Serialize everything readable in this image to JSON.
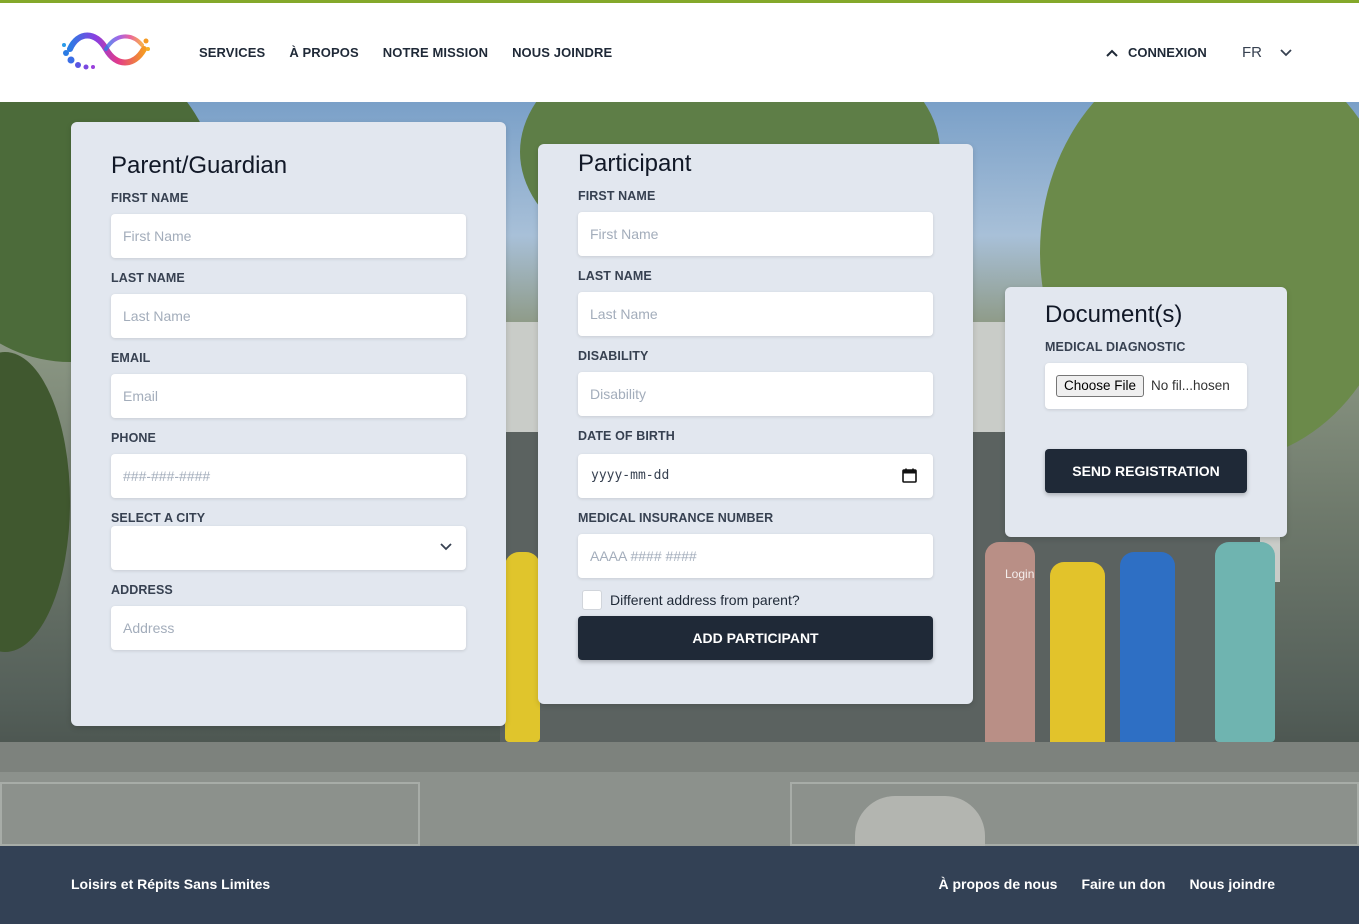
{
  "nav": {
    "items": [
      {
        "label": "SERVICES"
      },
      {
        "label": "À PROPOS"
      },
      {
        "label": "NOTRE MISSION"
      },
      {
        "label": "NOUS JOINDRE"
      }
    ],
    "connexion": "CONNEXION",
    "language": "FR"
  },
  "parent_form": {
    "title": "Parent/Guardian",
    "first_name_label": "FIRST NAME",
    "first_name_placeholder": "First Name",
    "last_name_label": "LAST NAME",
    "last_name_placeholder": "Last Name",
    "email_label": "EMAIL",
    "email_placeholder": "Email",
    "phone_label": "PHONE",
    "phone_placeholder": "###-###-####",
    "city_label": "SELECT A CITY",
    "city_value": "",
    "address_label": "ADDRESS",
    "address_placeholder": "Address"
  },
  "participant_form": {
    "title": "Participant",
    "first_name_label": "FIRST NAME",
    "first_name_placeholder": "First Name",
    "last_name_label": "LAST NAME",
    "last_name_placeholder": "Last Name",
    "disability_label": "DISABILITY",
    "disability_placeholder": "Disability",
    "dob_label": "DATE OF BIRTH",
    "dob_placeholder": "yyyy-mm-dd",
    "insurance_label": "MEDICAL INSURANCE NUMBER",
    "insurance_placeholder": "AAAA #### ####",
    "different_address_label": "Different address from parent?",
    "different_address_checked": false,
    "add_button": "ADD PARTICIPANT"
  },
  "documents": {
    "title": "Document(s)",
    "medical_label": "MEDICAL DIAGNOSTIC",
    "file_button": "Choose File",
    "file_status": "No fil...hosen",
    "send_button": "SEND REGISTRATION"
  },
  "background_login_text": "Login",
  "footer": {
    "brand": "Loisirs et Répits Sans Limites",
    "links": [
      {
        "label": "À propos de nous"
      },
      {
        "label": "Faire un don"
      },
      {
        "label": "Nous joindre"
      }
    ]
  },
  "colors": {
    "accent_line": "#84a82a",
    "card_bg": "#e2e7ef",
    "button_dark": "#1f2937",
    "footer_bg": "#334155"
  }
}
